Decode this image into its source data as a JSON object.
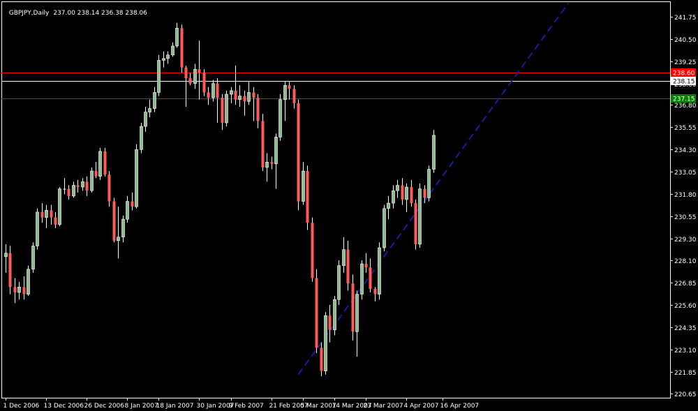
{
  "header": {
    "symbol_timeframe": "GBPJPY,Daily",
    "ohlc": "237.00 238.14 236.38 238.06"
  },
  "chart_data": {
    "type": "candlestick",
    "title": "GBPJPY,Daily",
    "ylim": [
      220.4,
      242.6
    ],
    "y_ticks": [
      "241.75",
      "240.50",
      "239.25",
      "238.00",
      "236.80",
      "235.55",
      "234.30",
      "233.05",
      "231.80",
      "230.55",
      "229.30",
      "228.10",
      "226.85",
      "225.60",
      "224.35",
      "223.10",
      "221.85",
      "220.65"
    ],
    "x_labels": [
      "1 Dec 2006",
      "13 Dec 2006",
      "26 Dec 2006",
      "8 Jan 2007",
      "18 Jan 2007",
      "30 Jan 2007",
      "9 Feb 2007",
      "21 Feb 2007",
      "5 Mar 2007",
      "14 Mar 2007",
      "23 Mar 2007",
      "4 Apr 2007",
      "16 Apr 2007"
    ],
    "x_label_bar_index": [
      0,
      9,
      18,
      27,
      34,
      43,
      50,
      59,
      66,
      73,
      80,
      89,
      97
    ],
    "horizontal_lines": [
      {
        "value": 238.6,
        "color": "#ff0000",
        "label": "238.60",
        "label_bg": "#ff0000"
      },
      {
        "value": 238.15,
        "color": "#ffffff",
        "label": "238.15",
        "label_bg": "#ffffff"
      },
      {
        "value": 237.15,
        "color": "#008000",
        "label": "237.15",
        "label_bg": "#008000"
      }
    ],
    "trendline": {
      "color": "#1c1c9c",
      "style": "dashed",
      "from": {
        "bar": 65,
        "value": 221.7
      },
      "to": {
        "bar": 125,
        "value": 242.5
      }
    },
    "colors": {
      "bull": "#8fbc8f",
      "bear": "#ff5a5a",
      "doji": "#ffffff",
      "wick_bull": "#ffffff",
      "wick_bear": "#ffffff",
      "axis": "#ffffff",
      "grid": "none"
    },
    "candles": [
      [
        228.3,
        229.0,
        227.4,
        228.5
      ],
      [
        228.5,
        228.9,
        226.2,
        226.6
      ],
      [
        226.6,
        227.1,
        225.7,
        226.3
      ],
      [
        226.3,
        226.9,
        225.9,
        226.6
      ],
      [
        226.6,
        227.2,
        225.9,
        226.2
      ],
      [
        226.2,
        227.8,
        226.1,
        227.6
      ],
      [
        227.6,
        229.1,
        227.4,
        228.9
      ],
      [
        228.9,
        231.0,
        228.7,
        230.8
      ],
      [
        230.8,
        231.3,
        230.2,
        230.5
      ],
      [
        230.5,
        231.2,
        229.9,
        230.9
      ],
      [
        230.9,
        231.2,
        230.1,
        230.5
      ],
      [
        230.5,
        230.8,
        229.9,
        230.1
      ],
      [
        230.1,
        232.2,
        230.0,
        232.1
      ],
      [
        232.1,
        232.7,
        231.8,
        232.1
      ],
      [
        232.1,
        232.3,
        231.5,
        231.7
      ],
      [
        231.7,
        232.5,
        231.6,
        232.3
      ],
      [
        232.3,
        232.6,
        231.9,
        232.2
      ],
      [
        232.2,
        232.7,
        232.0,
        232.5
      ],
      [
        232.5,
        232.8,
        231.7,
        232.0
      ],
      [
        232.0,
        233.3,
        231.9,
        233.1
      ],
      [
        233.1,
        233.6,
        232.7,
        232.8
      ],
      [
        232.8,
        234.4,
        232.6,
        234.2
      ],
      [
        234.2,
        234.4,
        232.8,
        232.9
      ],
      [
        232.9,
        233.1,
        231.1,
        231.4
      ],
      [
        231.4,
        231.6,
        229.1,
        229.2
      ],
      [
        229.2,
        231.1,
        228.2,
        229.4
      ],
      [
        229.4,
        230.6,
        229.1,
        230.4
      ],
      [
        230.4,
        231.7,
        230.2,
        231.4
      ],
      [
        231.4,
        231.9,
        230.9,
        231.1
      ],
      [
        231.1,
        234.6,
        231.0,
        234.3
      ],
      [
        234.3,
        235.8,
        234.1,
        235.6
      ],
      [
        235.6,
        236.7,
        235.3,
        236.4
      ],
      [
        236.4,
        237.1,
        236.1,
        236.6
      ],
      [
        236.6,
        237.8,
        236.4,
        237.5
      ],
      [
        237.5,
        239.6,
        237.3,
        239.3
      ],
      [
        239.3,
        239.8,
        238.9,
        239.4
      ],
      [
        239.4,
        239.8,
        239.1,
        239.6
      ],
      [
        239.6,
        240.3,
        239.5,
        240.1
      ],
      [
        240.1,
        241.4,
        240.0,
        241.1
      ],
      [
        241.1,
        241.3,
        238.6,
        238.9
      ],
      [
        238.9,
        239.0,
        236.7,
        238.3
      ],
      [
        238.3,
        238.6,
        237.9,
        238.0
      ],
      [
        238.0,
        239.1,
        237.7,
        238.8
      ],
      [
        238.8,
        240.4,
        237.1,
        238.6
      ],
      [
        238.6,
        238.8,
        237.3,
        237.5
      ],
      [
        237.5,
        237.8,
        236.8,
        237.2
      ],
      [
        237.2,
        238.2,
        237.0,
        238.0
      ],
      [
        238.0,
        238.3,
        235.8,
        237.2
      ],
      [
        237.2,
        237.4,
        235.4,
        235.8
      ],
      [
        235.8,
        237.6,
        235.6,
        237.4
      ],
      [
        237.4,
        237.8,
        236.9,
        237.6
      ],
      [
        237.6,
        239.0,
        236.8,
        237.1
      ],
      [
        237.1,
        237.9,
        236.7,
        237.3
      ],
      [
        237.3,
        237.6,
        236.2,
        237.0
      ],
      [
        237.0,
        238.1,
        236.8,
        237.5
      ],
      [
        237.5,
        237.8,
        235.9,
        237.2
      ],
      [
        237.2,
        237.4,
        235.5,
        235.9
      ],
      [
        235.9,
        236.3,
        233.1,
        233.3
      ],
      [
        233.3,
        234.1,
        232.5,
        233.6
      ],
      [
        233.6,
        233.9,
        233.2,
        233.5
      ],
      [
        233.5,
        235.2,
        232.1,
        235.0
      ],
      [
        235.0,
        237.4,
        234.8,
        237.1
      ],
      [
        237.1,
        238.1,
        235.9,
        237.9
      ],
      [
        237.9,
        238.1,
        237.1,
        237.7
      ],
      [
        237.7,
        237.9,
        236.6,
        236.9
      ],
      [
        236.9,
        237.1,
        230.9,
        231.4
      ],
      [
        231.4,
        233.6,
        231.2,
        233.1
      ],
      [
        233.1,
        233.4,
        229.8,
        230.2
      ],
      [
        230.2,
        230.5,
        226.9,
        227.1
      ],
      [
        227.1,
        227.6,
        222.9,
        223.2
      ],
      [
        223.2,
        223.5,
        221.6,
        221.9
      ],
      [
        221.9,
        225.2,
        221.7,
        225.0
      ],
      [
        225.0,
        225.6,
        223.5,
        224.2
      ],
      [
        224.2,
        226.1,
        223.9,
        225.9
      ],
      [
        225.9,
        228.1,
        225.6,
        227.8
      ],
      [
        227.8,
        229.4,
        227.4,
        228.7
      ],
      [
        228.7,
        229.2,
        226.4,
        226.8
      ],
      [
        226.8,
        227.3,
        223.6,
        224.1
      ],
      [
        224.1,
        226.4,
        222.7,
        226.2
      ],
      [
        226.2,
        228.1,
        225.9,
        227.9
      ],
      [
        227.9,
        228.5,
        227.4,
        227.7
      ],
      [
        227.7,
        228.2,
        226.3,
        226.5
      ],
      [
        226.5,
        226.6,
        225.8,
        226.2
      ],
      [
        226.2,
        229.1,
        225.9,
        228.8
      ],
      [
        228.8,
        231.2,
        228.6,
        231.0
      ],
      [
        231.0,
        231.7,
        230.4,
        231.3
      ],
      [
        231.3,
        232.3,
        231.0,
        232.0
      ],
      [
        232.0,
        232.6,
        231.6,
        232.3
      ],
      [
        232.3,
        232.7,
        231.2,
        231.5
      ],
      [
        231.5,
        232.4,
        230.8,
        232.2
      ],
      [
        232.2,
        232.6,
        231.1,
        231.3
      ],
      [
        231.3,
        231.5,
        228.7,
        229.0
      ],
      [
        229.0,
        232.4,
        228.8,
        232.1
      ],
      [
        232.1,
        232.3,
        231.3,
        231.6
      ],
      [
        231.6,
        233.4,
        231.4,
        233.2
      ],
      [
        233.2,
        235.4,
        233.0,
        235.1
      ]
    ]
  }
}
